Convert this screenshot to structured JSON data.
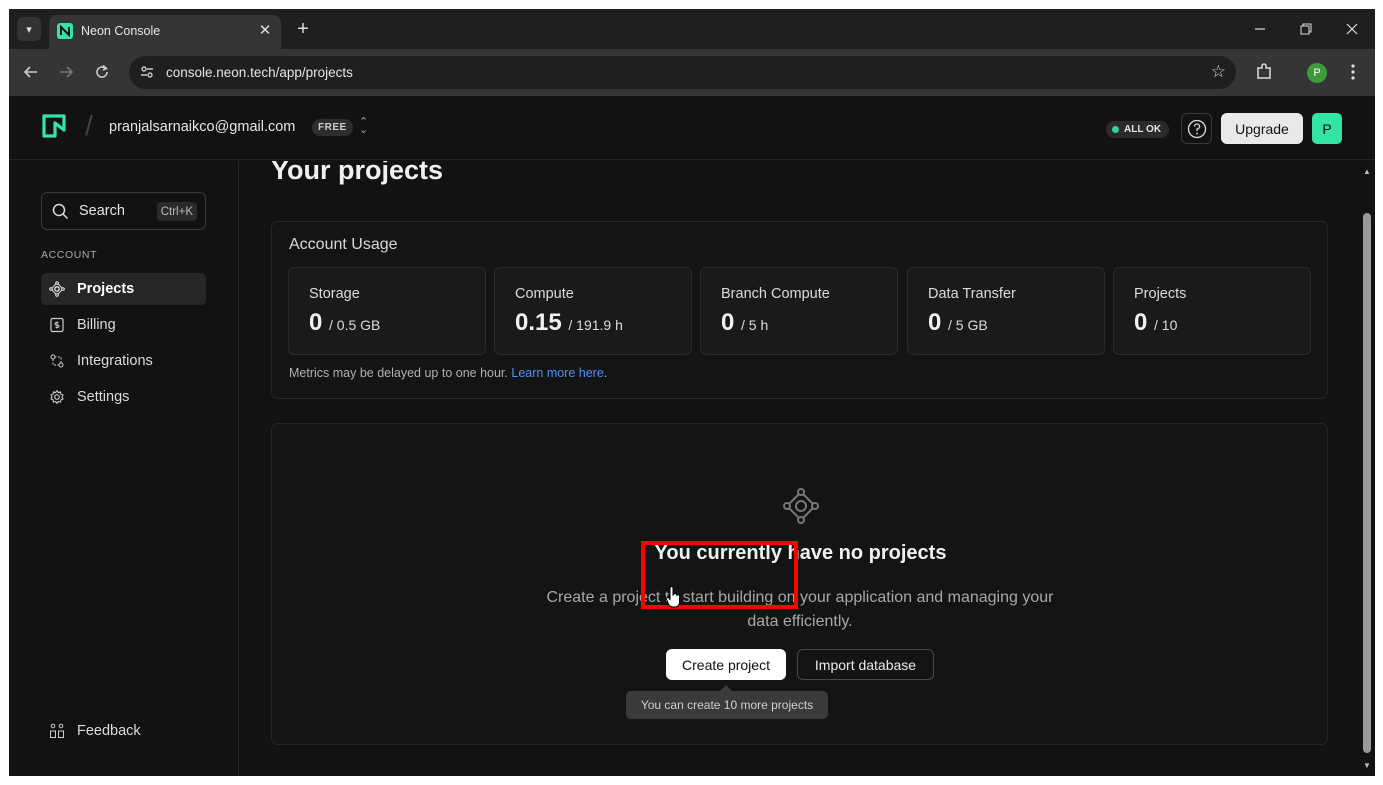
{
  "browser": {
    "tab_title": "Neon Console",
    "url": "console.neon.tech/app/projects",
    "profile_initial": "P",
    "new_tab": "+",
    "tab_close": "✕"
  },
  "header": {
    "account_email": "pranjalsarnaikco@gmail.com",
    "plan_badge": "FREE",
    "status_text": "ALL OK",
    "upgrade_label": "Upgrade",
    "avatar_initial": "P"
  },
  "sidebar": {
    "search_label": "Search",
    "search_shortcut": "Ctrl+K",
    "section_label": "ACCOUNT",
    "items": [
      {
        "label": "Projects",
        "icon": "projects-icon",
        "active": true
      },
      {
        "label": "Billing",
        "icon": "billing-icon",
        "active": false
      },
      {
        "label": "Integrations",
        "icon": "integrations-icon",
        "active": false
      },
      {
        "label": "Settings",
        "icon": "gear-icon",
        "active": false
      }
    ],
    "feedback_label": "Feedback"
  },
  "main": {
    "page_title": "Your projects",
    "usage": {
      "title": "Account Usage",
      "metrics": [
        {
          "label": "Storage",
          "value": "0",
          "limit": "/ 0.5 GB"
        },
        {
          "label": "Compute",
          "value": "0.15",
          "limit": "/ 191.9 h"
        },
        {
          "label": "Branch Compute",
          "value": "0",
          "limit": "/ 5 h"
        },
        {
          "label": "Data Transfer",
          "value": "0",
          "limit": "/ 5 GB"
        },
        {
          "label": "Projects",
          "value": "0",
          "limit": "/ 10"
        }
      ],
      "note": "Metrics may be delayed up to one hour.",
      "learn_more": "Learn more here",
      "note_end": "."
    },
    "empty_state": {
      "title": "You currently have no projects",
      "description": "Create a project to start building on your application and managing your data efficiently.",
      "create_label": "Create project",
      "import_label": "Import database",
      "tooltip": "You can create 10 more projects"
    }
  },
  "colors": {
    "accent": "#34d59a",
    "link": "#4d90fe",
    "highlight": "#ff0000"
  }
}
